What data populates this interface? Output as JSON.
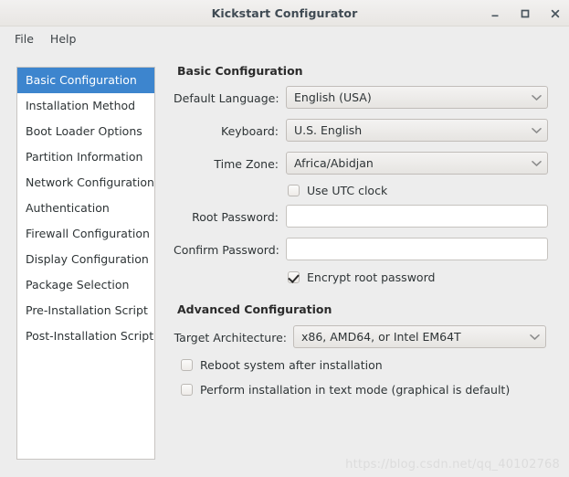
{
  "window": {
    "title": "Kickstart Configurator",
    "controls": [
      {
        "name": "minimize",
        "glyph": "minimize-icon"
      },
      {
        "name": "maximize",
        "glyph": "maximize-icon"
      },
      {
        "name": "close",
        "glyph": "close-icon"
      }
    ]
  },
  "menubar": {
    "items": [
      {
        "label": "File"
      },
      {
        "label": "Help"
      }
    ]
  },
  "sidebar": {
    "items": [
      {
        "label": "Basic Configuration",
        "selected": true
      },
      {
        "label": "Installation Method",
        "selected": false
      },
      {
        "label": "Boot Loader Options",
        "selected": false
      },
      {
        "label": "Partition Information",
        "selected": false
      },
      {
        "label": "Network Configuration",
        "selected": false
      },
      {
        "label": "Authentication",
        "selected": false
      },
      {
        "label": "Firewall Configuration",
        "selected": false
      },
      {
        "label": "Display Configuration",
        "selected": false
      },
      {
        "label": "Package Selection",
        "selected": false
      },
      {
        "label": "Pre-Installation Script",
        "selected": false
      },
      {
        "label": "Post-Installation Script",
        "selected": false
      }
    ],
    "selected_color": "#3d85ce"
  },
  "main": {
    "basic": {
      "heading": "Basic Configuration",
      "default_language": {
        "label": "Default Language:",
        "value": "English (USA)"
      },
      "keyboard": {
        "label": "Keyboard:",
        "value": "U.S. English"
      },
      "time_zone": {
        "label": "Time Zone:",
        "value": "Africa/Abidjan"
      },
      "use_utc": {
        "label": "Use UTC clock",
        "checked": false
      },
      "root_password": {
        "label": "Root Password:",
        "value": "",
        "placeholder": ""
      },
      "confirm_password": {
        "label": "Confirm Password:",
        "value": "",
        "placeholder": ""
      },
      "encrypt_root": {
        "label": "Encrypt root password",
        "checked": true
      }
    },
    "advanced": {
      "heading": "Advanced Configuration",
      "target_architecture": {
        "label": "Target Architecture:",
        "value": "x86, AMD64, or Intel EM64T"
      },
      "reboot_after": {
        "label": "Reboot system after installation",
        "checked": false
      },
      "text_mode": {
        "label": "Perform installation in text mode (graphical is default)",
        "checked": false
      }
    }
  },
  "watermark": {
    "text": "https://blog.csdn.net/qq_40102768"
  }
}
